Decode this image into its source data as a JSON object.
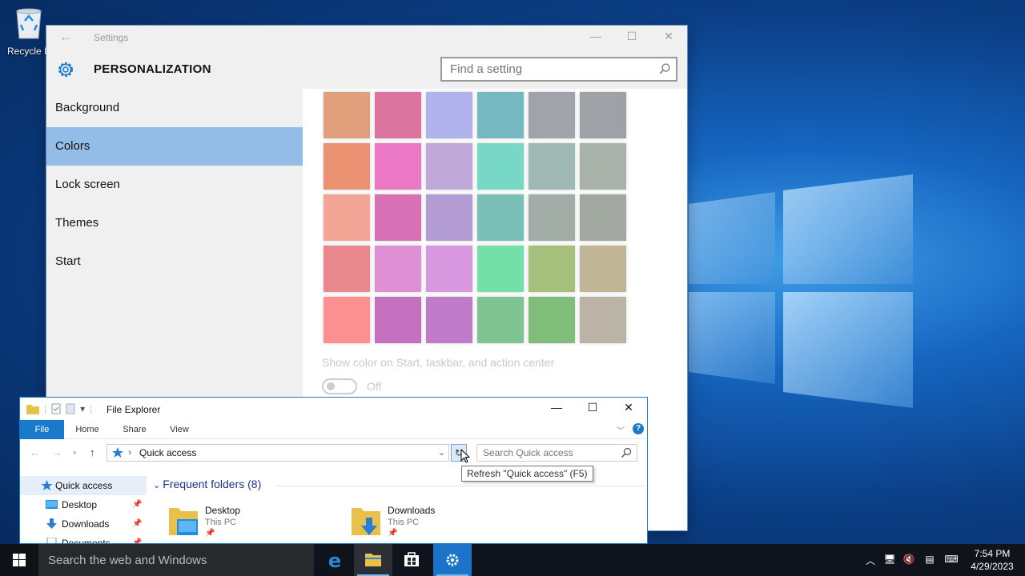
{
  "desktop": {
    "recycle_bin_label": "Recycle B"
  },
  "settings": {
    "window_title": "Settings",
    "page_title": "PERSONALIZATION",
    "search_placeholder": "Find a setting",
    "nav": [
      {
        "label": "Background"
      },
      {
        "label": "Colors",
        "selected": true
      },
      {
        "label": "Lock screen"
      },
      {
        "label": "Themes"
      },
      {
        "label": "Start"
      }
    ],
    "swatch_colors": [
      "#e0a07c",
      "#dc74a0",
      "#b0b2ec",
      "#76b8c0",
      "#a0a4aa",
      "#9ea2a6",
      "#ea9272",
      "#ea78c4",
      "#c0a8d8",
      "#78d8c6",
      "#a0b8b4",
      "#a8b2a8",
      "#f4a696",
      "#d870b6",
      "#b49cd4",
      "#7ac0b8",
      "#a2ada8",
      "#a0a8a0",
      "#e8888e",
      "#de90d4",
      "#d898e0",
      "#72e0a8",
      "#a4c07a",
      "#c0b496",
      "#fc9090",
      "#c470be",
      "#c07cc8",
      "#80c494",
      "#80bc7a",
      "#bab3a6"
    ],
    "show_color_label": "Show color on Start, taskbar, and action center",
    "toggle_state": "Off"
  },
  "explorer": {
    "title": "File Explorer",
    "tabs": [
      "File",
      "Home",
      "Share",
      "View"
    ],
    "address": "Quick access",
    "search_placeholder": "Search Quick access",
    "tooltip": "Refresh \"Quick access\" (F5)",
    "nav": [
      {
        "label": "Quick access",
        "selected": true
      },
      {
        "label": "Desktop",
        "pinned": true
      },
      {
        "label": "Downloads",
        "pinned": true
      },
      {
        "label": "Documents",
        "pinned": true
      }
    ],
    "section_title": "Frequent folders (8)",
    "folders": [
      {
        "name": "Desktop",
        "location": "This PC"
      },
      {
        "name": "Downloads",
        "location": "This PC"
      }
    ]
  },
  "taskbar": {
    "search_placeholder": "Search the web and Windows",
    "apps": [
      "edge-icon",
      "file-explorer-icon",
      "store-icon",
      "settings-icon"
    ],
    "time": "7:54 PM",
    "date": "4/29/2023"
  }
}
